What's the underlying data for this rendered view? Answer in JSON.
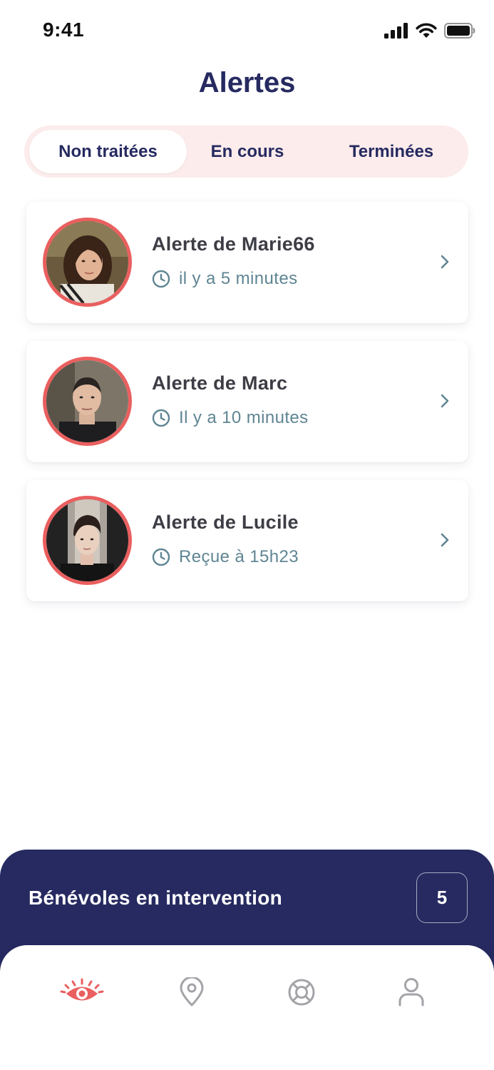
{
  "status_bar": {
    "time": "9:41"
  },
  "header": {
    "title": "Alertes"
  },
  "tabs": [
    {
      "label": "Non traitées",
      "active": true
    },
    {
      "label": "En cours",
      "active": false
    },
    {
      "label": "Terminées",
      "active": false
    }
  ],
  "alerts": [
    {
      "title": "Alerte de Marie66",
      "time": "il y a 5 minutes"
    },
    {
      "title": "Alerte de Marc",
      "time": "Il y a 10 minutes"
    },
    {
      "title": "Alerte de Lucile",
      "time": "Reçue à 15h23"
    }
  ],
  "volunteers": {
    "label": "Bénévoles en intervention",
    "count": "5"
  },
  "nav": [
    {
      "icon": "eye-icon",
      "active": true
    },
    {
      "icon": "map-pin-icon",
      "active": false
    },
    {
      "icon": "lifebuoy-icon",
      "active": false
    },
    {
      "icon": "user-icon",
      "active": false
    }
  ],
  "colors": {
    "brand_navy": "#262a60",
    "accent_red": "#ea5f5f",
    "tab_background": "#fcecec",
    "muted_teal": "#5f8593",
    "inactive_icon": "#a3a3a8"
  }
}
